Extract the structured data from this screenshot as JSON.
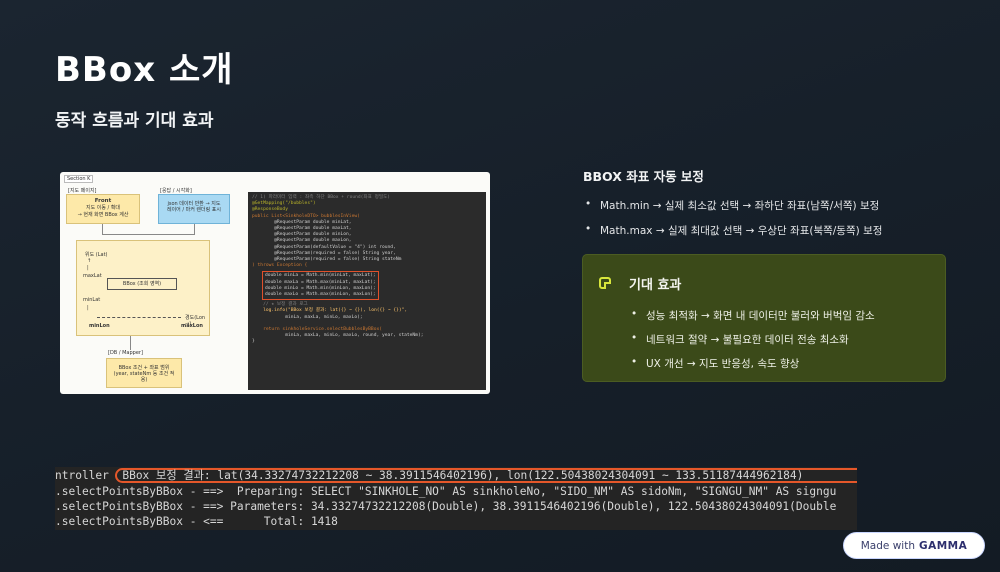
{
  "slide": {
    "title": "BBox 소개",
    "subtitle": "동작 흐름과 기대 효과"
  },
  "diagram": {
    "tag": "Section K",
    "region_left": "[지도 페이지]",
    "region_right": "[응답 / 시각화]",
    "front_title": "Front",
    "front_desc": "지도 이동 / 확대",
    "front_desc2": "→ 현재 화면 BBox 계산",
    "resp_box": "json 데이터 반환 → 지도 레이어 / 마커 렌더링 표시",
    "map_lat": "위도 (Lat)",
    "map_maxlat": "maxLat",
    "map_bbox": "BBox (조회 영역)",
    "map_minlat": "minLat",
    "map_lon": "경도(Lon →)",
    "map_minlon": "minLon",
    "map_maxlon": "maxLon",
    "mapper_label": "[DB / Mapper]",
    "mapper_box": "BBox 조건 + 좌표 범위 (year, stateNm 등 조건 적용)"
  },
  "code": {
    "comment1": "// 1) 파라미터 입력 : 좌측 하단 BBox + round(좌표 정밀도)",
    "line_map": "@GetMapping(\"/bubbles\")",
    "line_body": "@ResponseBody",
    "line_sig": "public List<SinkholeDTO> bubblesInView(",
    "p1": "        @RequestParam double minLat,",
    "p2": "        @RequestParam double maxLat,",
    "p3": "        @RequestParam double minLon,",
    "p4": "        @RequestParam double maxLon,",
    "p5": "        @RequestParam(defaultValue = \"4\") int round,",
    "p6": "        @RequestParam(required = false) String year,",
    "p7": "        @RequestParam(required = false) String stateNm",
    "throws": ") throws Exception {",
    "m1": "double minLa = Math.min(minLat, maxLat);",
    "m2": "double maxLa = Math.max(minLat, maxLat);",
    "m3": "double minLo = Math.min(minLon, maxLon);",
    "m4": "double maxLo = Math.max(minLon, maxLon);",
    "comment2": "    // ★ 보정 결과 로그",
    "log1": "    log.info(\"BBox 보정 결과: lat({} ~ {}), lon({} ~ {})\",",
    "log2": "            minLa, maxLa, minLo, maxLo);",
    "ret1": "    return sinkholeService.selectBubblesByBBox(",
    "ret2": "            minLa, maxLa, minLo, maxLo, round, year, stateNm);",
    "close": "}"
  },
  "bbox_section": {
    "heading": "BBOX 좌표 자동 보정",
    "items": [
      "Math.min → 실제 최소값 선택 → 좌하단 좌표(남쪽/서쪽) 보정",
      "Math.max → 실제 최대값 선택 → 우상단 좌표(북쪽/동쪽) 보정"
    ]
  },
  "effect": {
    "title": "기대 효과",
    "icon": "note-icon",
    "items": [
      "성능 최적화 → 화면 내 데이터만 불러와 버벅임 감소",
      "네트워크 절약 → 불필요한 데이터 전송 최소화",
      "UX 개선 → 지도 반응성, 속도 향상"
    ],
    "accent": "#d8e63c"
  },
  "log": {
    "lines": [
      "ntroller  BBox 보정 결과: lat(34.33274732212208 ~ 38.3911546402196), lon(122.50438024304091 ~ 133.51187444962184)",
      ".selectPointsByBBox - ==>  Preparing: SELECT \"SINKHOLE_NO\" AS sinkholeNo, \"SIDO_NM\" AS sidoNm, \"SIGNGU_NM\" AS signgu",
      ".selectPointsByBBox - ==> Parameters: 34.33274732212208(Double), 38.3911546402196(Double), 122.50438024304091(Double",
      ".selectPointsByBBox - <==      Total: 1418"
    ],
    "highlight_color": "#e5572a"
  },
  "badge": {
    "prefix": "Made with",
    "brand": "GAMMA"
  }
}
